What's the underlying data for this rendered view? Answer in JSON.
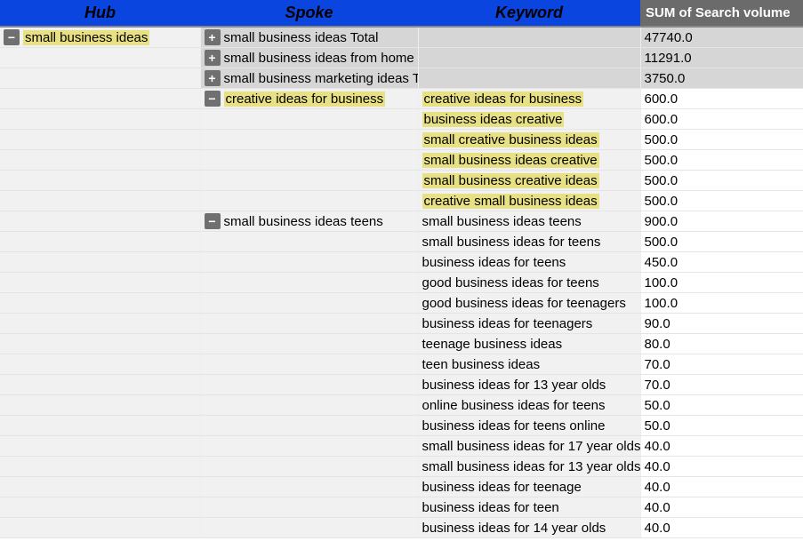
{
  "headers": {
    "hub": "Hub",
    "spoke": "Spoke",
    "keyword": "Keyword",
    "sum": "SUM of Search volume"
  },
  "icons": {
    "plus": "+",
    "minus": "−"
  },
  "rows": [
    {
      "hub_icon": "minus",
      "hub_text": "small business ideas",
      "hub_hl": true,
      "spoke_icon": "plus",
      "spoke_text": "small business ideas Total",
      "spoke_bg": "total",
      "keyword_text": "",
      "keyword_bg": "total",
      "sum": "47740.0",
      "sum_bg": "total"
    },
    {
      "spoke_icon": "plus",
      "spoke_text": "small business ideas from home Total",
      "spoke_bg": "total",
      "keyword_bg": "total",
      "sum": "11291.0",
      "sum_bg": "total"
    },
    {
      "spoke_icon": "plus",
      "spoke_text": "small business marketing ideas Total",
      "spoke_bg": "total",
      "keyword_bg": "total",
      "sum": "3750.0",
      "sum_bg": "total"
    },
    {
      "spoke_icon": "minus",
      "spoke_text": "creative ideas for business",
      "spoke_hl": true,
      "keyword_text": "creative ideas for business",
      "keyword_hl": true,
      "sum": "600.0"
    },
    {
      "keyword_text": "business ideas creative",
      "keyword_hl": true,
      "sum": "600.0"
    },
    {
      "keyword_text": "small creative business ideas",
      "keyword_hl": true,
      "sum": "500.0"
    },
    {
      "keyword_text": "small business ideas creative",
      "keyword_hl": true,
      "sum": "500.0"
    },
    {
      "keyword_text": "small business creative ideas",
      "keyword_hl": true,
      "sum": "500.0"
    },
    {
      "keyword_text": "creative small business ideas",
      "keyword_hl": true,
      "sum": "500.0"
    },
    {
      "spoke_icon": "minus",
      "spoke_text": "small business ideas teens",
      "keyword_text": "small business ideas teens",
      "sum": "900.0"
    },
    {
      "keyword_text": "small business ideas for teens",
      "sum": "500.0"
    },
    {
      "keyword_text": "business ideas for teens",
      "sum": "450.0"
    },
    {
      "keyword_text": "good business ideas for teens",
      "sum": "100.0"
    },
    {
      "keyword_text": "good business ideas for teenagers",
      "sum": "100.0"
    },
    {
      "keyword_text": "business ideas for teenagers",
      "sum": "90.0"
    },
    {
      "keyword_text": "teenage business ideas",
      "sum": "80.0"
    },
    {
      "keyword_text": "teen business ideas",
      "sum": "70.0"
    },
    {
      "keyword_text": "business ideas for 13 year olds",
      "sum": "70.0"
    },
    {
      "keyword_text": "online business ideas for teens",
      "sum": "50.0"
    },
    {
      "keyword_text": "business ideas for teens online",
      "sum": "50.0"
    },
    {
      "keyword_text": "small business ideas for 17 year olds",
      "sum": "40.0"
    },
    {
      "keyword_text": "small business ideas for 13 year olds",
      "sum": "40.0"
    },
    {
      "keyword_text": "business ideas for teenage",
      "sum": "40.0"
    },
    {
      "keyword_text": "business ideas for teen",
      "sum": "40.0"
    },
    {
      "keyword_text": "business ideas for 14 year olds",
      "sum": "40.0"
    }
  ]
}
